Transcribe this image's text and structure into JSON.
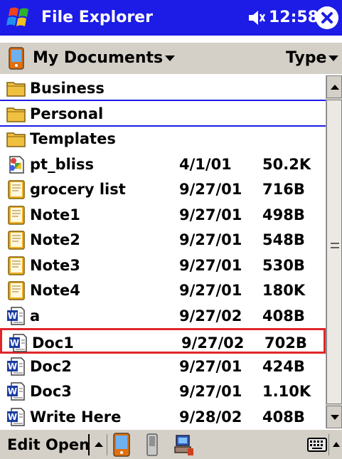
{
  "titlebar": {
    "title": "File Explorer",
    "time": "12:58"
  },
  "header": {
    "folder": "My Documents",
    "sort": "Type"
  },
  "files": [
    {
      "name": "Business",
      "date": "",
      "size": "",
      "icon": "folder-icon"
    },
    {
      "name": "Personal",
      "date": "",
      "size": "",
      "icon": "folder-icon"
    },
    {
      "name": "Templates",
      "date": "",
      "size": "",
      "icon": "folder-icon"
    },
    {
      "name": "pt_bliss",
      "date": "4/1/01",
      "size": "50.2K",
      "icon": "image-file-icon"
    },
    {
      "name": "grocery list",
      "date": "9/27/01",
      "size": "716B",
      "icon": "note-file-icon"
    },
    {
      "name": "Note1",
      "date": "9/27/01",
      "size": "498B",
      "icon": "note-file-icon"
    },
    {
      "name": "Note2",
      "date": "9/27/01",
      "size": "548B",
      "icon": "note-file-icon"
    },
    {
      "name": "Note3",
      "date": "9/27/01",
      "size": "530B",
      "icon": "note-file-icon"
    },
    {
      "name": "Note4",
      "date": "9/27/01",
      "size": "180K",
      "icon": "note-file-icon"
    },
    {
      "name": "a",
      "date": "9/27/02",
      "size": "408B",
      "icon": "word-file-icon"
    },
    {
      "name": "Doc1",
      "date": "9/27/02",
      "size": "702B",
      "icon": "word-file-icon"
    },
    {
      "name": "Doc2",
      "date": "9/27/01",
      "size": "424B",
      "icon": "word-file-icon"
    },
    {
      "name": "Doc3",
      "date": "9/27/01",
      "size": "1.10K",
      "icon": "word-file-icon"
    },
    {
      "name": "Write Here",
      "date": "9/28/02",
      "size": "408B",
      "icon": "word-file-icon"
    }
  ],
  "menu": {
    "edit": "Edit",
    "open": "Open"
  },
  "colors": {
    "titlebar": "#1c1ce6",
    "selection_outline": "#e0262a",
    "chrome": "#d4d0c8"
  }
}
